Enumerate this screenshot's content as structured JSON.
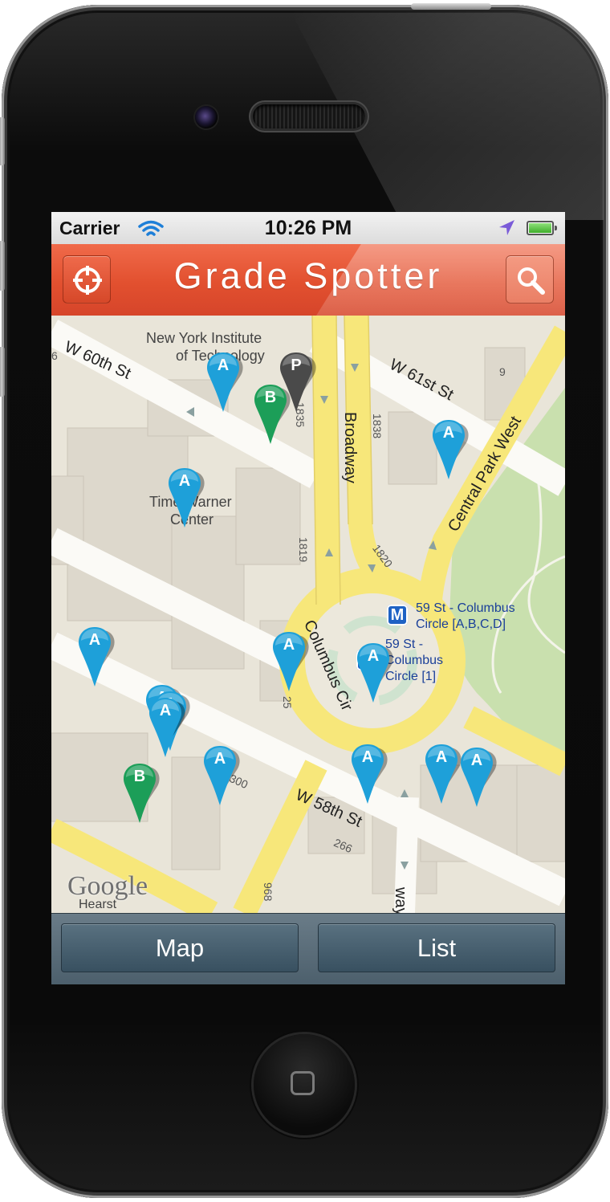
{
  "status_bar": {
    "carrier": "Carrier",
    "time": "10:26 PM"
  },
  "nav": {
    "title": "Grade Spotter",
    "left_icon": "crosshair-locate-icon",
    "right_icon": "search-icon",
    "accent": "#e2502f"
  },
  "map": {
    "streets": {
      "w60": "W 60th St",
      "w61": "W 61st St",
      "broadway": "Broadway",
      "central_park_west": "Central Park West",
      "columbus_cir": "Columbus Cir",
      "w58": "W 58th St",
      "broadway_partial": "way"
    },
    "places": {
      "nyit_line1": "New York Institute",
      "nyit_line2": "of Technology",
      "twc_line1": "Time Warner",
      "twc_line2": "Center"
    },
    "numbers": {
      "n1835": "1835",
      "n1838": "1838",
      "n1819": "1819",
      "n1820": "1820",
      "n25": "25",
      "n300": "300",
      "n266": "266",
      "n968": "968",
      "n9": "9",
      "n6": "6"
    },
    "subway": {
      "badge": "M",
      "station1_line1": "59 St - Columbus",
      "station1_line2": "Circle [A,B,C,D]",
      "station2_line1": "59 St -",
      "station2_line2": "Columbus",
      "station2_line3": "Circle [1]"
    },
    "attribution": {
      "google": "Google",
      "hearst": "Hearst"
    },
    "pin_colors": {
      "A": "#1ea0d9",
      "B": "#1c9e58",
      "P": "#4a4a4a"
    },
    "pins": {
      "p1": "A",
      "p2": "P",
      "p3": "B",
      "p4": "A",
      "p5": "A",
      "p6": "A",
      "p7": "A",
      "p8": "A",
      "p9": "A",
      "p10": "A",
      "p11": "A",
      "p12": "B",
      "p13": "A",
      "p14": "A",
      "p15": "A",
      "p16": "A"
    }
  },
  "tabs": {
    "map": "Map",
    "list": "List"
  }
}
